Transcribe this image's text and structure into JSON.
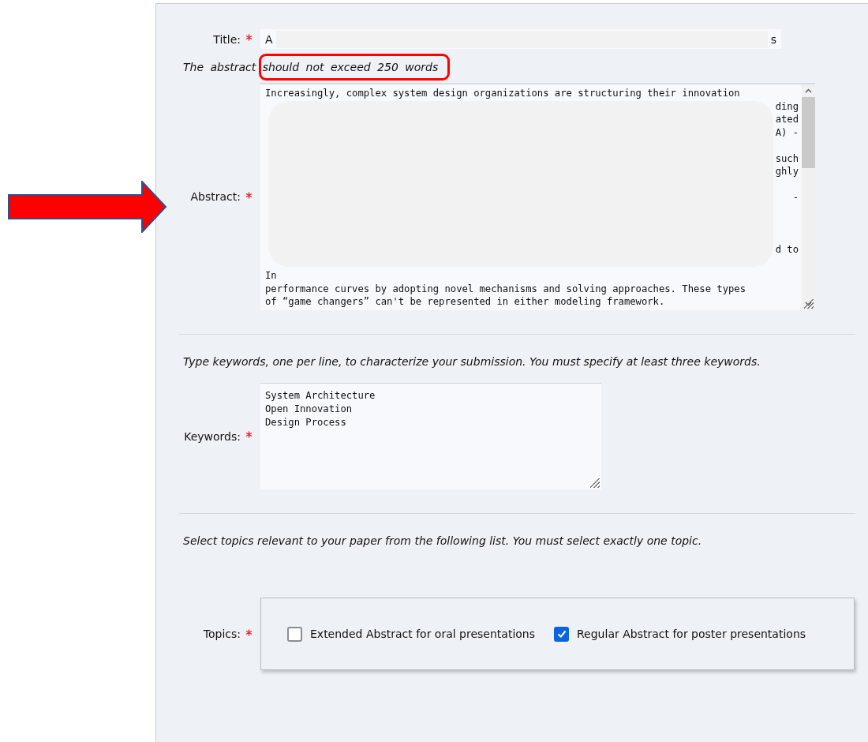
{
  "title_field": {
    "label": "Title:",
    "required": true,
    "value_start": "A",
    "value_end": "s"
  },
  "abstract_note": "The abstract should not exceed 250 words",
  "abstract_field": {
    "label": "Abstract:",
    "required": true,
    "lines": [
      {
        "kind": "text",
        "left": "Increasingly, complex system design organizations are structuring their innovation"
      },
      {
        "kind": "text",
        "right": "ding"
      },
      {
        "kind": "text",
        "right": "ated"
      },
      {
        "kind": "text",
        "right": "A) -"
      },
      {
        "kind": "blank"
      },
      {
        "kind": "text",
        "right": "such"
      },
      {
        "kind": "text",
        "right": "ghly"
      },
      {
        "kind": "blank"
      },
      {
        "kind": "text",
        "right": "-"
      },
      {
        "kind": "blank"
      },
      {
        "kind": "blank"
      },
      {
        "kind": "blank"
      },
      {
        "kind": "text",
        "right": "d to"
      },
      {
        "kind": "blank"
      },
      {
        "kind": "text",
        "left": "In"
      },
      {
        "kind": "text",
        "left": "performance curves by adopting novel mechanisms and solving approaches. These types"
      },
      {
        "kind": "text",
        "left": "of “game changers” can't be represented in either modeling framework."
      }
    ]
  },
  "keywords_note": "Type keywords, one per line, to characterize your submission. You must specify at least three keywords.",
  "keywords_field": {
    "label": "Keywords:",
    "required": true,
    "lines": [
      "System Architecture",
      "Open Innovation",
      "Design Process"
    ]
  },
  "topics_note": "Select topics relevant to your paper from the following list. You must select exactly one topic.",
  "topics_field": {
    "label": "Topics:",
    "required": true,
    "options": [
      {
        "label": "Extended Abstract for oral presentations",
        "checked": false
      },
      {
        "label": "Regular Abstract for poster presentations",
        "checked": true
      }
    ]
  }
}
